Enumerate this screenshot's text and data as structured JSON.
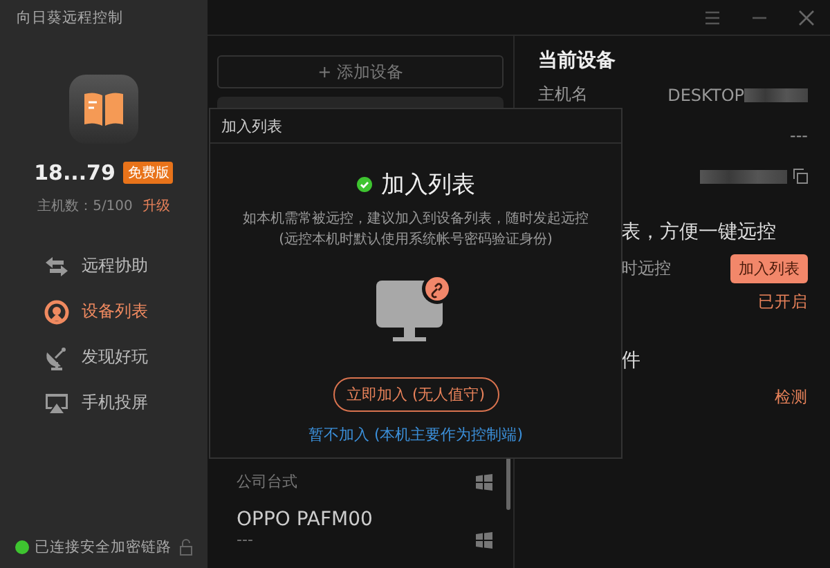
{
  "sidebar": {
    "app_title": "向日葵远程控制",
    "account": "18...79",
    "plan_badge": "免费版",
    "host_count": "主机数：5/100",
    "upgrade_link": "升级",
    "nav": [
      {
        "label": "远程协助",
        "kind": "swap",
        "selected": false
      },
      {
        "label": "设备列表",
        "kind": "target",
        "selected": true
      },
      {
        "label": "发现好玩",
        "kind": "dish",
        "selected": false
      },
      {
        "label": "手机投屏",
        "kind": "cast",
        "selected": false
      }
    ],
    "status": "已连接安全加密链路"
  },
  "device_list": {
    "add_button": "+ 添加设备",
    "devices": [
      {
        "detail": "公司台式"
      },
      {
        "name": "OPPO PAFM00",
        "detail": "---"
      }
    ]
  },
  "current_device": {
    "title": "当前设备",
    "host_label": "主机名",
    "host_value": "DESKTOP",
    "row_2_value": "---",
    "section_partial": "表，方便一键远控",
    "row_partial": "时远控",
    "join_button": "加入列表",
    "status": "已开启",
    "section_2_partial": "件",
    "check_link": "检测"
  },
  "dialog": {
    "title": "加入列表",
    "heading": "加入列表",
    "description": [
      "如本机需常被远控，建议加入到设备列表，随时发起远控",
      "(远控本机时默认使用系统帐号密码验证身份)"
    ],
    "primary_button": "立即加入 (无人值守)",
    "secondary_link": "暂不加入 (本机主要作为控制端)"
  }
}
